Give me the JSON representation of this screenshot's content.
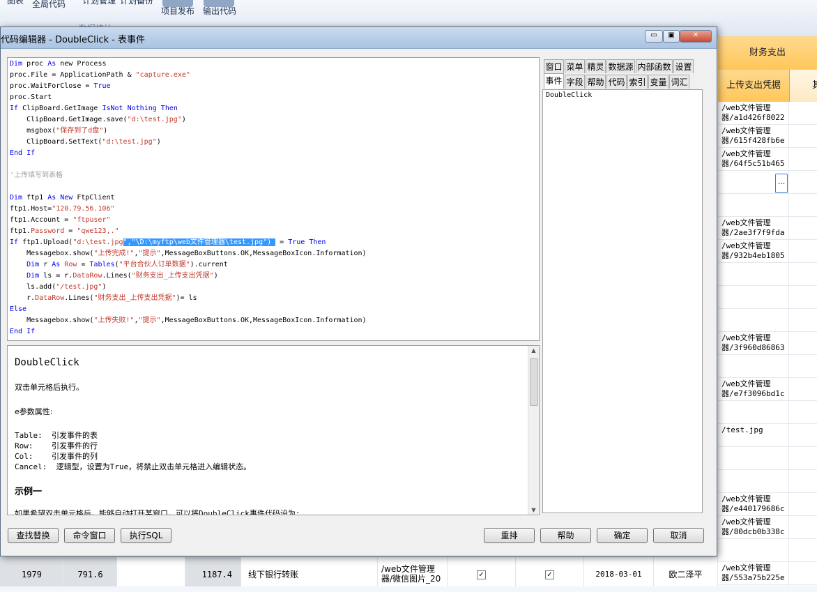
{
  "background": {
    "ribbon": {
      "items": [
        "图表",
        "全局代码",
        "计划管理",
        "计划备份",
        "项目发布",
        "输出代码",
        "数据统计"
      ]
    },
    "grid_right": {
      "header_group": "财务支出",
      "header_col": "上传支出凭据",
      "header_next": "其",
      "rows": [
        {
          "l1": "/web文件管理",
          "l2": "器/a1d426f8022"
        },
        {
          "l1": "/web文件管理",
          "l2": "器/615f428fb6e"
        },
        {
          "l1": "/web文件管理",
          "l2": "器/64f5c51b465"
        },
        {
          "l1": "",
          "l2": ""
        },
        {
          "l1": "",
          "l2": ""
        },
        {
          "l1": "/web文件管理",
          "l2": "器/2ae3f7f9fda"
        },
        {
          "l1": "/web文件管理",
          "l2": "器/932b4eb1805"
        },
        {
          "l1": "",
          "l2": ""
        },
        {
          "l1": "",
          "l2": ""
        },
        {
          "l1": "",
          "l2": ""
        },
        {
          "l1": "/web文件管理",
          "l2": "器/3f960d86863"
        },
        {
          "l1": "",
          "l2": ""
        },
        {
          "l1": "/web文件管理",
          "l2": "器/e7f3096bd1c"
        },
        {
          "l1": "",
          "l2": ""
        },
        {
          "l1": "/test.jpg",
          "l2": ""
        },
        {
          "l1": "",
          "l2": ""
        },
        {
          "l1": "",
          "l2": ""
        },
        {
          "l1": "/web文件管理",
          "l2": "器/e440179686c"
        },
        {
          "l1": "/web文件管理",
          "l2": "器/80dcb0b338c"
        },
        {
          "l1": "",
          "l2": ""
        },
        {
          "l1": "/web文件管理",
          "l2": "器/553a75b225e"
        }
      ],
      "ellipsis": "..."
    },
    "grid_bottom": {
      "c1": "1979",
      "c2": "791.6",
      "c3": "1187.4",
      "c4": "线下银行转账",
      "c5a": "/web文件管理",
      "c5b": "器/微信图片_20",
      "check1": "✓",
      "check2": "✓",
      "c6": "2018-03-01",
      "c7": "欧二泽平"
    }
  },
  "dialog": {
    "title": "代码编辑器 - DoubleClick - 表事件",
    "window_buttons": {
      "minimize": "▭",
      "restore": "▣",
      "close": "✕"
    },
    "code": [
      [
        {
          "t": "Dim",
          "c": "kw"
        },
        {
          "t": " proc "
        },
        {
          "t": "As",
          "c": "kw"
        },
        {
          "t": " new Process"
        }
      ],
      [
        {
          "t": "proc.File = ApplicationPath & "
        },
        {
          "t": "\"capture.exe\"",
          "c": "str"
        }
      ],
      [
        {
          "t": "proc.WaitForClose = "
        },
        {
          "t": "True",
          "c": "kw"
        }
      ],
      [
        {
          "t": "proc.Start"
        }
      ],
      [
        {
          "t": "If",
          "c": "kw"
        },
        {
          "t": " ClipBoard.GetImage "
        },
        {
          "t": "IsNot",
          "c": "kw"
        },
        {
          "t": " "
        },
        {
          "t": "Nothing",
          "c": "kw"
        },
        {
          "t": " "
        },
        {
          "t": "Then",
          "c": "kw"
        }
      ],
      [
        {
          "t": "    ClipBoard.GetImage.save("
        },
        {
          "t": "\"d:\\test.jpg\"",
          "c": "str"
        },
        {
          "t": ")"
        }
      ],
      [
        {
          "t": "    msgbox("
        },
        {
          "t": "\"保存到了d盘\"",
          "c": "str"
        },
        {
          "t": ")"
        }
      ],
      [
        {
          "t": "    ClipBoard.SetText("
        },
        {
          "t": "\"d:\\test.jpg\"",
          "c": "str"
        },
        {
          "t": ")"
        }
      ],
      [
        {
          "t": "End If",
          "c": "kw"
        }
      ],
      [],
      [
        {
          "t": "'上传填写到表格",
          "c": "cmt"
        }
      ],
      [],
      [
        {
          "t": "Dim",
          "c": "kw"
        },
        {
          "t": " ftp1 "
        },
        {
          "t": "As",
          "c": "kw"
        },
        {
          "t": " "
        },
        {
          "t": "New",
          "c": "kw"
        },
        {
          "t": " FtpClient"
        }
      ],
      [
        {
          "t": "ftp1.Host="
        },
        {
          "t": "\"120.79.56.106\"",
          "c": "str"
        }
      ],
      [
        {
          "t": "ftp1.Account = "
        },
        {
          "t": "\"ftpuser\"",
          "c": "str"
        }
      ],
      [
        {
          "t": "ftp1."
        },
        {
          "t": "Password",
          "c": "prop"
        },
        {
          "t": " = "
        },
        {
          "t": "\"qwe123,.\"",
          "c": "str"
        }
      ],
      [
        {
          "t": "If",
          "c": "kw"
        },
        {
          "t": " ftp1.Upload("
        },
        {
          "t": "\"d:\\test.jpg",
          "c": "str"
        },
        {
          "t": "\",\"\\D:\\myftp\\web文件管理器\\test.jpg\") ",
          "c": "sel"
        },
        {
          "t": " = "
        },
        {
          "t": "True",
          "c": "kw"
        },
        {
          "t": " "
        },
        {
          "t": "Then",
          "c": "kw"
        }
      ],
      [
        {
          "t": "    Messagebox.show("
        },
        {
          "t": "\"上传完成!\"",
          "c": "str"
        },
        {
          "t": ","
        },
        {
          "t": "\"提示\"",
          "c": "str"
        },
        {
          "t": ",MessageBoxButtons.OK,MessageBoxIcon.Information)"
        }
      ],
      [
        {
          "t": "    "
        },
        {
          "t": "Dim",
          "c": "kw"
        },
        {
          "t": " r "
        },
        {
          "t": "As",
          "c": "kw"
        },
        {
          "t": " "
        },
        {
          "t": "Row",
          "c": "prop"
        },
        {
          "t": " = "
        },
        {
          "t": "Tables",
          "c": "kw"
        },
        {
          "t": "("
        },
        {
          "t": "\"平台合伙人订单数据\"",
          "c": "str"
        },
        {
          "t": ").current"
        }
      ],
      [
        {
          "t": "    "
        },
        {
          "t": "Dim",
          "c": "kw"
        },
        {
          "t": " ls = r."
        },
        {
          "t": "DataRow",
          "c": "prop"
        },
        {
          "t": ".Lines("
        },
        {
          "t": "\"财务支出_上传支出凭据\"",
          "c": "str"
        },
        {
          "t": ")"
        }
      ],
      [
        {
          "t": "    ls.add("
        },
        {
          "t": "\"/test.jpg\"",
          "c": "str"
        },
        {
          "t": ")"
        }
      ],
      [
        {
          "t": "    r."
        },
        {
          "t": "DataRow",
          "c": "prop"
        },
        {
          "t": ".Lines("
        },
        {
          "t": "\"财务支出_上传支出凭据\"",
          "c": "str"
        },
        {
          "t": ")= ls"
        }
      ],
      [
        {
          "t": "Else",
          "c": "kw"
        }
      ],
      [
        {
          "t": "    Messagebox.show("
        },
        {
          "t": "\"上传失败!\"",
          "c": "str"
        },
        {
          "t": ","
        },
        {
          "t": "\"提示\"",
          "c": "str"
        },
        {
          "t": ",MessageBoxButtons.OK,MessageBoxIcon.Information)"
        }
      ],
      [
        {
          "t": "End If",
          "c": "kw"
        }
      ]
    ],
    "help": {
      "title": "DoubleClick",
      "desc": "双击单元格后执行。",
      "e_props": "e参数属性:",
      "table": "Table:  引发事件的表",
      "row": "Row:    引发事件的行",
      "col": "Col:    引发事件的列",
      "cancel": "Cancel:  逻辑型，设置为True，将禁止双击单元格进入编辑状态。",
      "example": "示例一",
      "example_text": "如果希望双击单元格后，能够自动打开某窗口，可以将DoubleClick事件代码设为:"
    },
    "tabs_row1": [
      "窗口",
      "菜单",
      "精灵",
      "数据源",
      "内部函数",
      "设置"
    ],
    "tabs_row2": [
      "事件",
      "字段",
      "帮助",
      "代码",
      "索引",
      "变量",
      "词汇"
    ],
    "event_list_item": "DoubleClick",
    "buttons": {
      "find_replace": "查找替换",
      "command_window": "命令窗口",
      "exec_sql": "执行SQL",
      "rearrange": "重排",
      "help": "帮助",
      "ok": "确定",
      "cancel": "取消"
    }
  }
}
